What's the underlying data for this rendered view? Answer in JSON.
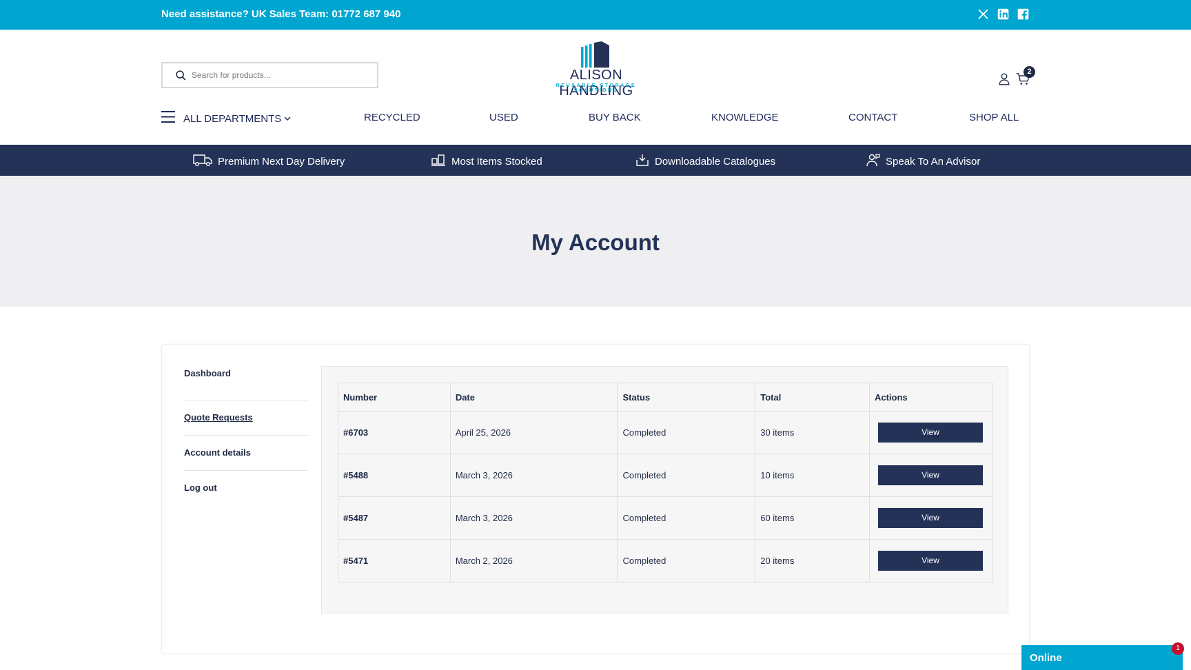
{
  "topbar": {
    "assistance": "Need assistance? UK Sales Team: 01772 687 940",
    "social": [
      "x-icon",
      "linkedin-icon",
      "facebook-icon"
    ]
  },
  "search": {
    "placeholder": "Search for products..."
  },
  "logo": {
    "name": "ALISON HANDLING",
    "tagline": "REUSABLE STORAGE SOLUTIONS"
  },
  "cart": {
    "count": "2"
  },
  "nav": {
    "departments": "ALL DEPARTMENTS",
    "items": [
      "RECYCLED",
      "USED",
      "BUY BACK",
      "KNOWLEDGE",
      "CONTACT",
      "SHOP ALL"
    ]
  },
  "usps": [
    {
      "label": "Premium Next Day Delivery",
      "icon": "truck-icon"
    },
    {
      "label": "Most Items Stocked",
      "icon": "pallet-icon"
    },
    {
      "label": "Downloadable Catalogues",
      "icon": "download-icon"
    },
    {
      "label": "Speak To An Advisor",
      "icon": "advisor-icon"
    }
  ],
  "hero": {
    "title": "My Account"
  },
  "account_nav": [
    "Dashboard",
    "Quote Requests",
    "Account details",
    "Log out"
  ],
  "orders": {
    "headers": [
      "Number",
      "Date",
      "Status",
      "Total",
      "Actions"
    ],
    "rows": [
      {
        "number": "#6703",
        "date": "April 25, 2026",
        "status": "Completed",
        "total": "30 items",
        "action": "View"
      },
      {
        "number": "#5488",
        "date": "March 3, 2026",
        "status": "Completed",
        "total": "10 items",
        "action": "View"
      },
      {
        "number": "#5487",
        "date": "March 3, 2026",
        "status": "Completed",
        "total": "60 items",
        "action": "View"
      },
      {
        "number": "#5471",
        "date": "March 2, 2026",
        "status": "Completed",
        "total": "20 items",
        "action": "View"
      }
    ]
  },
  "chat": {
    "label": "Online",
    "badge": "1"
  },
  "colors": {
    "topbar": "#00a6d0",
    "navy": "#243257",
    "hero_bg": "#efeff1"
  }
}
